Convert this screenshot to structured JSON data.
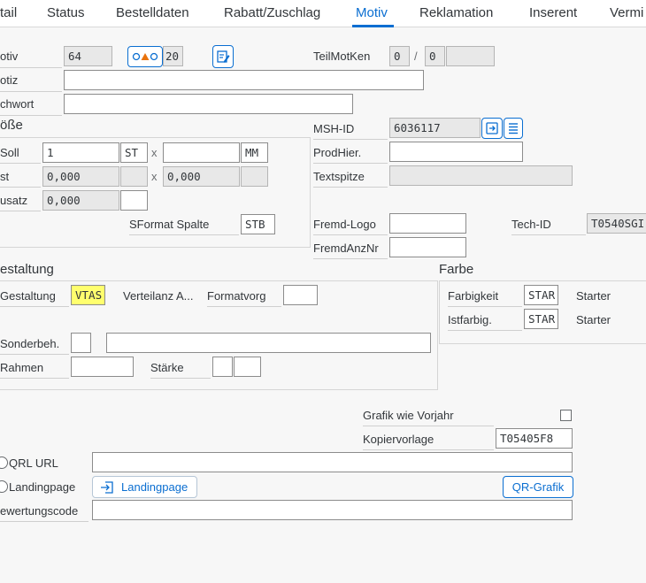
{
  "tabs": [
    {
      "label": "tail",
      "active": false
    },
    {
      "label": "Status",
      "active": false
    },
    {
      "label": "Bestelldaten",
      "active": false
    },
    {
      "label": "Rabatt/Zuschlag",
      "active": false
    },
    {
      "label": "Motiv",
      "active": true
    },
    {
      "label": "Reklamation",
      "active": false
    },
    {
      "label": "Inserent",
      "active": false
    },
    {
      "label": "Vermi",
      "active": false
    }
  ],
  "motiv": {
    "label": "otiv",
    "value": "64",
    "shape_count": "20",
    "teilmotken_label": "TeilMotKen",
    "teilmotken_1": "0",
    "teilmotken_sep": "/",
    "teilmotken_2": "0",
    "teilmotken_3": ""
  },
  "notiz": {
    "label": "otiz",
    "value": ""
  },
  "stichwort": {
    "label": "chwort",
    "value": ""
  },
  "groesse": {
    "title": "öße",
    "soll_label": "Soll",
    "soll_value": "1",
    "soll_unit": "ST",
    "soll_x": "x",
    "soll_value2": "",
    "soll_unit2": "MM",
    "ist_label": "st",
    "ist_value": "0,000",
    "ist_unit": "",
    "ist_x": "x",
    "ist_value2": "0,000",
    "ist_unit2": "",
    "zusatz_label": "usatz",
    "zusatz_value": "0,000",
    "zusatz_unit": "",
    "sformat_label": "SFormat Spalte",
    "sformat_value": "STB"
  },
  "right_fields": {
    "msh_label": "MSH-ID",
    "msh_value": "6036117",
    "prodhier_label": "ProdHier.",
    "prodhier_value": "",
    "textspitze_label": "Textspitze",
    "textspitze_value": "",
    "fremdlogo_label": "Fremd-Logo",
    "fremdlogo_value": "",
    "techid_label": "Tech-ID",
    "techid_value": "T0540SGI",
    "fremdanznr_label": "FremdAnzNr",
    "fremdanznr_value": ""
  },
  "gestaltung": {
    "title": "estaltung",
    "gestaltung_label": "Gestaltung",
    "gestaltung_value": "VTAS",
    "verteilanz_label": "Verteilanz A...",
    "formatvorg_label": "Formatvorg",
    "formatvorg_value": "",
    "sonderbeh_label": "Sonderbeh.",
    "sonderbeh_value1": "",
    "sonderbeh_value2": "",
    "rahmen_label": "Rahmen",
    "rahmen_value": "",
    "staerke_label": "Stärke",
    "staerke_value1": "",
    "staerke_value2": ""
  },
  "farbe": {
    "title": "Farbe",
    "farbigkeit_label": "Farbigkeit",
    "farbigkeit_value": "STAR",
    "farbigkeit_text": "Starter",
    "istfarbig_label": "Istfarbig.",
    "istfarbig_value": "STAR",
    "istfarbig_text": "Starter"
  },
  "bottom": {
    "grafik_label": "Grafik wie Vorjahr",
    "kopiervorlage_label": "Kopiervorlage",
    "kopiervorlage_value": "T05405F8",
    "qrl_label": "QRL URL",
    "qrl_value": "",
    "landingpage_label": "Landingpage",
    "landingpage_button": "Landingpage",
    "qr_button": "QR-Grafik",
    "bewertungscode_label": "ewertungscode",
    "bewertungscode_value": ""
  },
  "colors": {
    "accent": "#0a6ed1",
    "highlight": "#ffff6e",
    "background": "#f7f7f7"
  },
  "icons": [
    "shapes-icon",
    "edit-note-icon",
    "open-link-icon",
    "list-icon",
    "landingpage-icon"
  ]
}
